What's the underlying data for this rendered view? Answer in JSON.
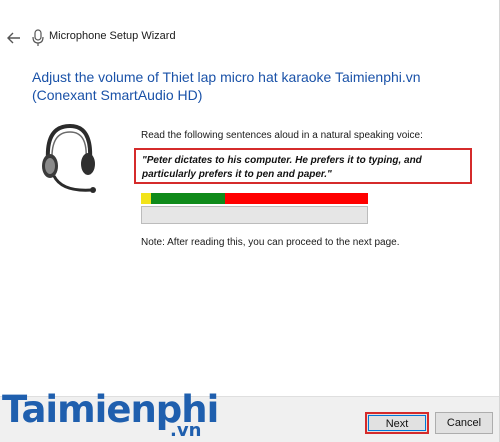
{
  "window": {
    "title": "Microphone Setup Wizard"
  },
  "main": {
    "heading": "Adjust the volume of Thiet lap micro hat karaoke Taimienphi.vn (Conexant SmartAudio HD)",
    "instruction": "Read the following sentences aloud in a natural speaking voice:",
    "sentence": "\"Peter dictates to his computer. He prefers it to typing, and particularly prefers it to pen and paper.\"",
    "note": "Note: After reading this, you can proceed to the next page.",
    "progress_value": 0
  },
  "footer": {
    "next_label": "Next",
    "cancel_label": "Cancel"
  },
  "watermark": {
    "main": "Taimienphi",
    "sub": ".vn"
  },
  "icons": {
    "back": "back-arrow-icon",
    "microphone": "microphone-icon",
    "headset": "headset-icon"
  },
  "colors": {
    "heading": "#1a52a8",
    "highlight_border": "#d52b2b",
    "meter_yellow": "#f2e31a",
    "meter_green": "#0f8a1a",
    "meter_red": "#ff0000",
    "watermark": "#1f5fae"
  }
}
